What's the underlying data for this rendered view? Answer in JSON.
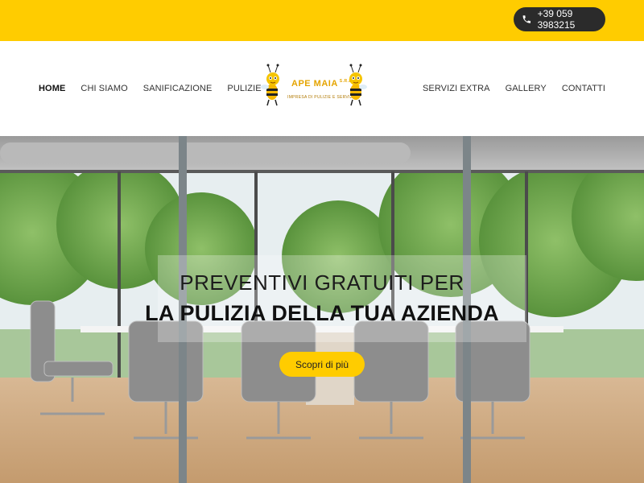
{
  "topbar": {
    "phone": "+39 059 3983215"
  },
  "nav": {
    "left": [
      "HOME",
      "CHI SIAMO",
      "SANIFICAZIONE",
      "PULIZIE"
    ],
    "right": [
      "SERVIZI EXTRA",
      "GALLERY",
      "CONTATTI"
    ],
    "active": "HOME"
  },
  "logo": {
    "title": "APE MAIA",
    "suffix": "S.R.L.",
    "subtitle": "IMPRESA DI PULIZIE E SERVIZI"
  },
  "hero": {
    "line1": "PREVENTIVI GRATUITI PER",
    "line2": "LA PULIZIA DELLA TUA AZIENDA",
    "cta": "Scopri di più"
  },
  "colors": {
    "accent": "#ffcc00",
    "dark": "#2b2b2b"
  }
}
